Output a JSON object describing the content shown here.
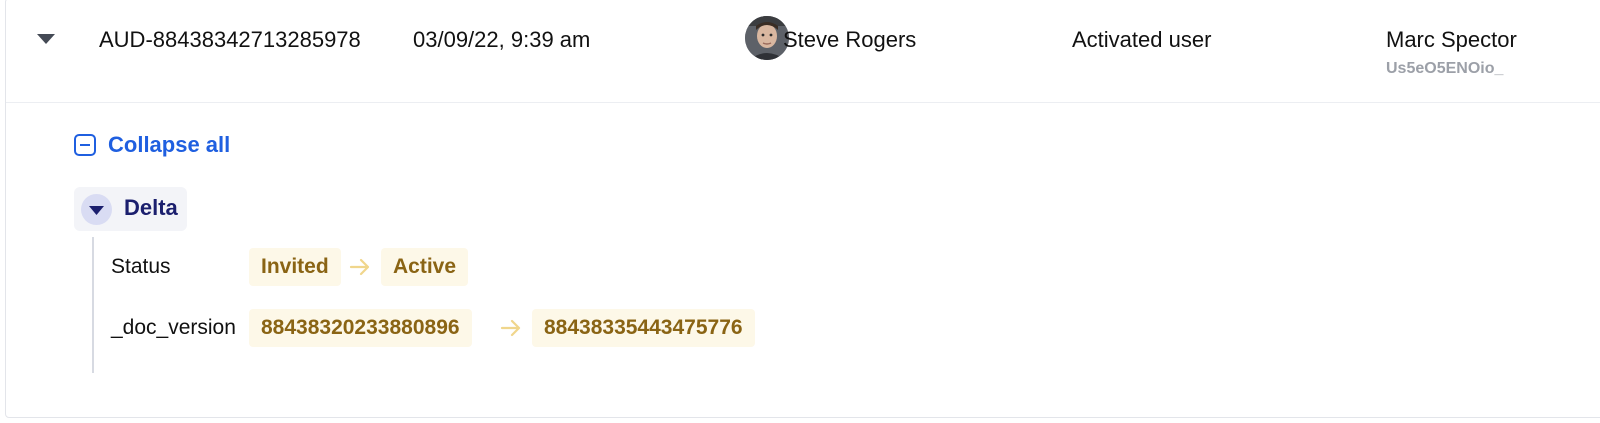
{
  "entry": {
    "id": "AUD-88438342713285978",
    "timestamp": "03/09/22, 9:39 am",
    "actor": {
      "name": "Steve Rogers",
      "avatar_icon": "user-photo-avatar"
    },
    "action": "Activated user",
    "target": {
      "name": "Marc Spector",
      "id": "Us5eO5ENOio_"
    }
  },
  "details": {
    "collapse_all_label": "Collapse all",
    "delta": {
      "label": "Delta",
      "fields": [
        {
          "name": "Status",
          "old_value": "Invited",
          "new_value": "Active"
        },
        {
          "name": "_doc_version",
          "old_value": "88438320233880896",
          "new_value": "88438335443475776"
        }
      ]
    }
  },
  "colors": {
    "link_blue": "#1f5fe0",
    "delta_text": "#1b1f6e",
    "pill_background": "#fdf8e8",
    "pill_text": "#8a6414",
    "arrow": "#f0d68c"
  }
}
